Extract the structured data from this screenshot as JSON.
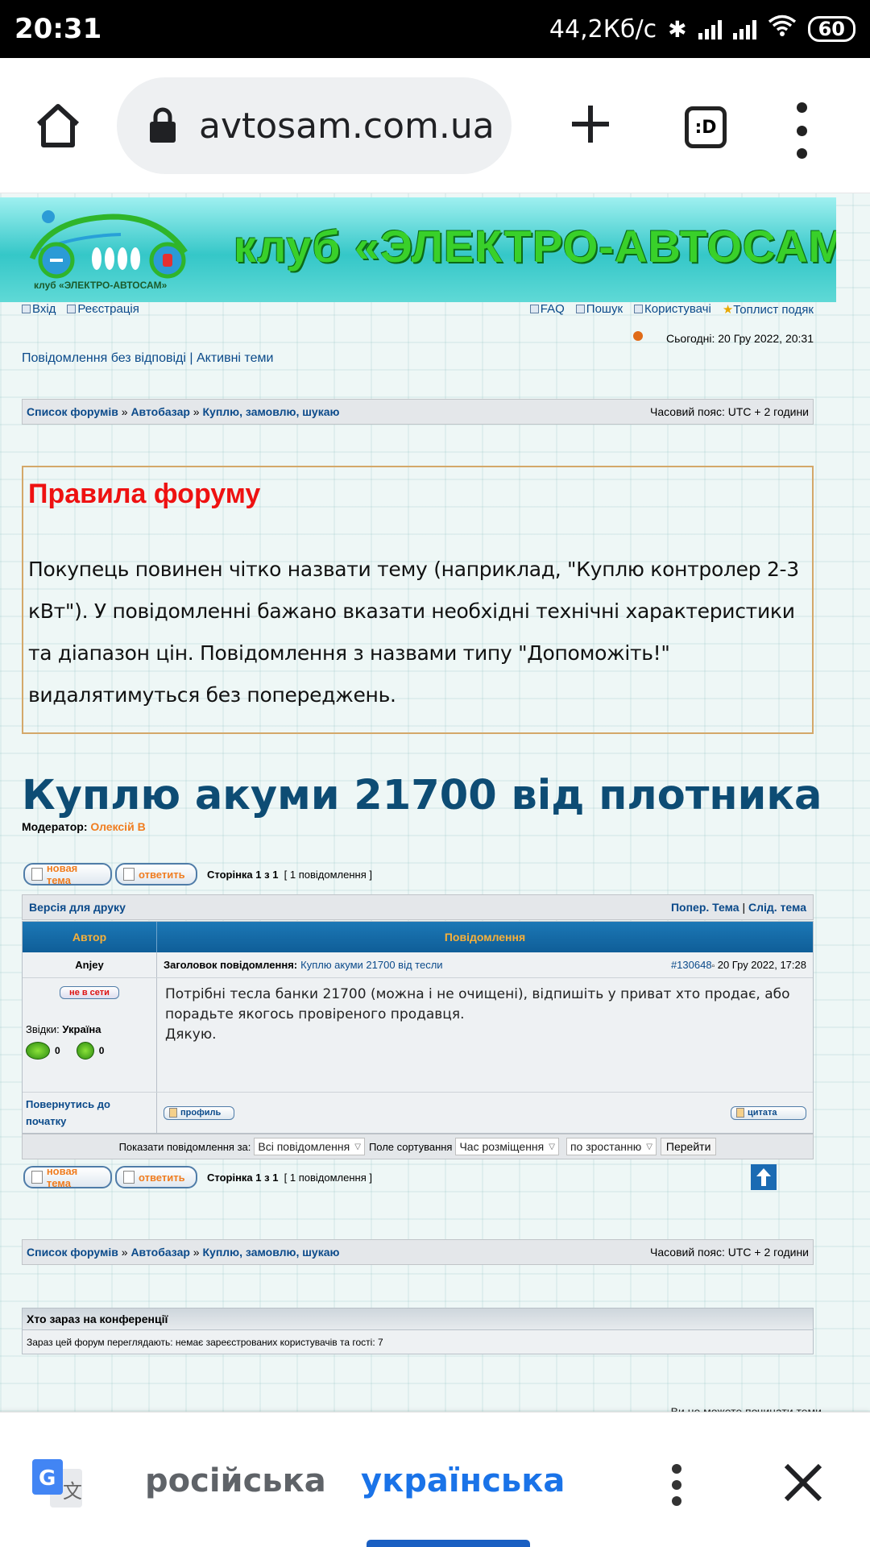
{
  "status_bar": {
    "time": "20:31",
    "network_speed": "44,2Кб/с",
    "battery": "60"
  },
  "browser": {
    "url": "avtosam.com.ua",
    "tabs_label": ":D"
  },
  "site": {
    "banner_title": "клуб «ЭЛЕКТРО-АВТОСАМ»",
    "logo_caption": "клуб «ЭЛЕКТРО-АВТОСАМ»",
    "nav_left": [
      {
        "label": "Вхід"
      },
      {
        "label": "Реєстрація"
      }
    ],
    "nav_right": [
      {
        "label": "FAQ"
      },
      {
        "label": "Пошук"
      },
      {
        "label": "Користувачі"
      },
      {
        "label": "Топлист подяк"
      }
    ],
    "today": "Сьогодні: 20 Гру 2022, 20:31",
    "quick_links": "Повідомлення без відповіді | Активні теми"
  },
  "breadcrumb": {
    "forums": "Список форумів",
    "sep": " » ",
    "cat": "Автобазар",
    "sub": "Куплю, замовлю, шукаю",
    "timezone": "Часовий пояс: UTC + 2 години"
  },
  "rules": {
    "title": "Правила форуму",
    "body": "Покупець повинен чітко назвати тему (наприклад, \"Куплю контролер 2-3 кВт\"). У повідомленні бажано вказати необхідні технічні характеристики та діапазон цін. Повідомлення з назвами типу \"Допоможіть!\" видалятимуться без попереджень."
  },
  "topic": {
    "title": "Куплю акуми 21700 від плотника",
    "moderator_label": "Модератор:",
    "moderator_name": "Олексій В"
  },
  "buttons": {
    "new_topic": "новая тема",
    "reply": "ответить",
    "profile": "профиль",
    "quote": "цитата",
    "go": "Перейти"
  },
  "pagination": {
    "page_text": "Сторінка 1 з 1",
    "count_text": "[ 1 повідомлення ]"
  },
  "print_bar": {
    "print": "Версія для друку",
    "prev": "Попер. Тема",
    "sep": " | ",
    "next": "Слід. тема"
  },
  "post_table": {
    "col_author": "Автор",
    "col_message": "Повідомлення",
    "author": "Anjey",
    "subject_label": "Заголовок повідомлення:",
    "subject": "Куплю акуми 21700 від тесли",
    "post_id": "#130648",
    "post_date": "20 Гру 2022, 17:28",
    "offline_label": "не в сети",
    "from_label": "Звідки:",
    "from_value": "Україна",
    "medal_count_1": "0",
    "medal_count_2": "0",
    "body_line1": "Потрібні тесла банки 21700 (можна і не очищені), відпишіть у приват хто продає, або порадьте якогось провіреного продавця.",
    "body_line2": "Дякую.",
    "back_to_top": "Повернутись до початку"
  },
  "sort_bar": {
    "show_label": "Показати повідомлення за:",
    "show_value": "Всі повідомлення",
    "sort_label": "Поле сортування",
    "sort_value": "Час розміщення",
    "order_value": "по зростанню"
  },
  "who_is_online": {
    "title": "Хто зараз на конференції",
    "body": "Зараз цей форум переглядають: немає зареєстрованих користувачів та гості: 7"
  },
  "cutoff_text": "Ви не можете починати теми",
  "translate_bar": {
    "source_lang": "російська",
    "target_lang": "українська"
  }
}
